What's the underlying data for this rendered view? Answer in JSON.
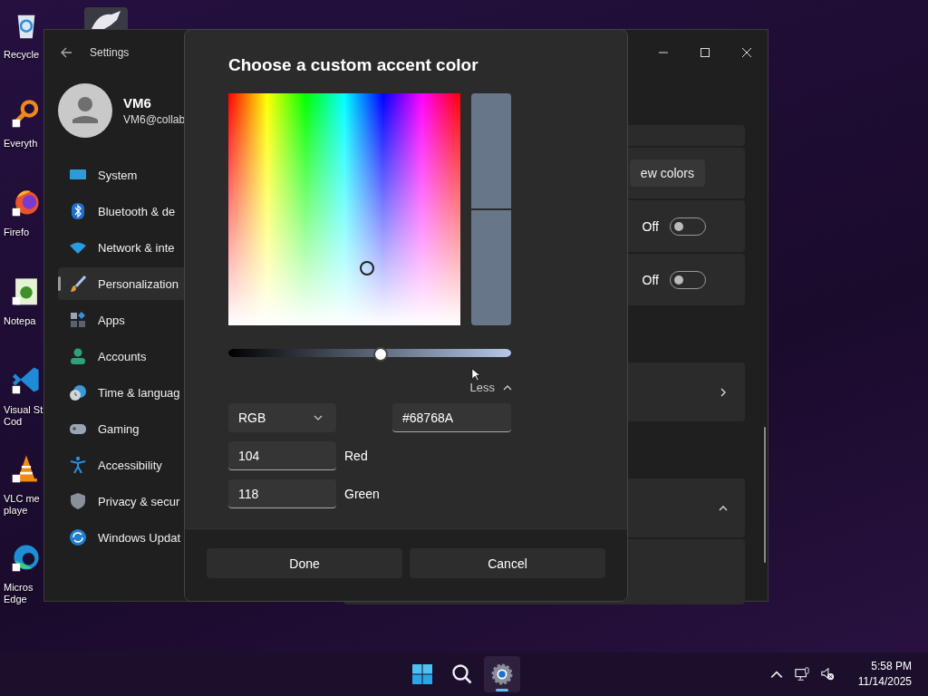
{
  "desktop_icons": [
    {
      "kind": "recycle",
      "lines": [
        "Recycle"
      ]
    },
    {
      "kind": "magnifier",
      "lines": [
        "Everyth"
      ]
    },
    {
      "kind": "firefox",
      "lines": [
        "Firefo"
      ]
    },
    {
      "kind": "notepad",
      "lines": [
        "Notepa"
      ]
    },
    {
      "kind": "vscode",
      "lines": [
        "Visual St",
        "Cod"
      ]
    },
    {
      "kind": "vlc",
      "lines": [
        "VLC me",
        "playe"
      ]
    },
    {
      "kind": "edge",
      "lines": [
        "Micros",
        "Edge"
      ]
    }
  ],
  "settings": {
    "title": "Settings",
    "user": {
      "name": "VM6",
      "email": "VM6@collab"
    },
    "nav": [
      {
        "kind": "system",
        "label": "System",
        "selected": false
      },
      {
        "kind": "bluetooth",
        "label": "Bluetooth & de",
        "selected": false
      },
      {
        "kind": "network",
        "label": "Network & inte",
        "selected": false
      },
      {
        "kind": "personalization",
        "label": "Personalization",
        "selected": true
      },
      {
        "kind": "apps",
        "label": "Apps",
        "selected": false
      },
      {
        "kind": "accounts",
        "label": "Accounts",
        "selected": false
      },
      {
        "kind": "time",
        "label": "Time & languag",
        "selected": false
      },
      {
        "kind": "gaming",
        "label": "Gaming",
        "selected": false
      },
      {
        "kind": "accessibility",
        "label": "Accessibility",
        "selected": false
      },
      {
        "kind": "privacy",
        "label": "Privacy & secur",
        "selected": false
      },
      {
        "kind": "update",
        "label": "Windows Updat",
        "selected": false
      }
    ],
    "colors_button": "ew colors",
    "toggles": [
      {
        "label": "Off",
        "on": false
      },
      {
        "label": "Off",
        "on": false
      }
    ]
  },
  "dialog": {
    "title": "Choose a custom accent color",
    "brightness": {
      "level": 0.54
    },
    "less": "Less",
    "mode": "RGB",
    "hex": "#68768A",
    "channels": [
      {
        "value": "104",
        "label": "Red"
      },
      {
        "value": "118",
        "label": "Green"
      }
    ],
    "buttons": [
      "Done",
      "Cancel"
    ]
  },
  "taskbar": {
    "apps": [
      {
        "kind": "start",
        "selected": false
      },
      {
        "kind": "search",
        "selected": false
      },
      {
        "kind": "settings",
        "selected": true
      }
    ],
    "time": "5:58 PM",
    "date": "11/14/2025"
  }
}
